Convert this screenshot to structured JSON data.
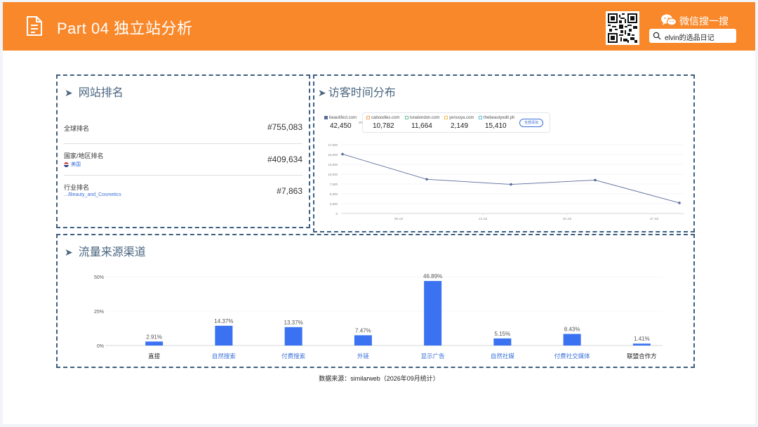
{
  "header": {
    "title": "Part 04 独立站分析",
    "wechat_label": "微信搜一搜",
    "search_text": "elvin的选品日记",
    "bg_color": "#f9882b"
  },
  "ranking": {
    "title": "网站排名",
    "rows": [
      {
        "label": "全球排名",
        "sub": "",
        "value": "#755,083"
      },
      {
        "label": "国家/地区排名",
        "sub": "美国",
        "value": "#409,634"
      },
      {
        "label": "行业排名",
        "sub": ".../Beauty_and_Cosmetics",
        "value": "#7,863"
      }
    ]
  },
  "visits": {
    "title": "访客时间分布",
    "main_site": {
      "name": "beautifect.com",
      "value": "42,450",
      "color": "#5b6c9a"
    },
    "vs": "vs.",
    "competitors": [
      {
        "name": "caboodles.com",
        "value": "10,782",
        "color": "#f0a060"
      },
      {
        "name": "lunalondon.com",
        "value": "11,664",
        "color": "#6cc0a0"
      },
      {
        "name": "yensoya.com",
        "value": "2,149",
        "color": "#f2c050"
      },
      {
        "name": "thebeautyedit.ph",
        "value": "15,410",
        "color": "#60c0d8"
      }
    ],
    "all_button": "全部添加",
    "chart_data": {
      "type": "line",
      "series": [
        {
          "name": "beautifect.com",
          "values": [
            15100,
            8700,
            7400,
            8500,
            2700
          ]
        }
      ],
      "ylim": [
        0,
        17500
      ],
      "yticks": [
        "0",
        "2,500",
        "5,000",
        "7,500",
        "10,000",
        "12,500",
        "15,000",
        "17,500"
      ],
      "xticks": [
        "06 Jul",
        "13 Jul",
        "20 Jul",
        "27 Jul"
      ],
      "line_color": "#5b6c9a"
    }
  },
  "traffic": {
    "title": "流量来源渠道",
    "chart_data": {
      "type": "bar",
      "categories": [
        "直接",
        "自然搜索",
        "付费搜索",
        "外链",
        "显示广告",
        "自然社媒",
        "付费社交媒体",
        "联盟合作方"
      ],
      "values": [
        2.91,
        14.37,
        13.37,
        7.47,
        46.89,
        5.15,
        8.43,
        1.41
      ],
      "value_labels": [
        "2.91%",
        "14.37%",
        "13.37%",
        "7.47%",
        "46.89%",
        "5.15%",
        "8.43%",
        "1.41%"
      ],
      "category_link": [
        false,
        true,
        true,
        true,
        true,
        true,
        true,
        false
      ],
      "yticks": [
        "0%",
        "25%",
        "50%"
      ],
      "ylim": [
        0,
        50
      ],
      "bar_color": "#3a72f2"
    }
  },
  "source_note": "数据来源：similarweb（2026年09月统计）"
}
